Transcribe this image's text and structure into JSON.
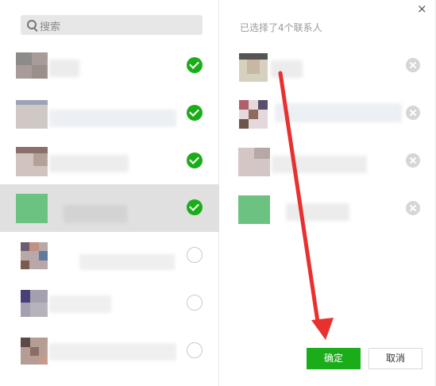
{
  "search": {
    "placeholder": "搜索"
  },
  "right": {
    "title": "已选择了4个联系人"
  },
  "buttons": {
    "ok": "确定",
    "cancel": "取消"
  },
  "close": "×",
  "colors": {
    "accent": "#1aad19",
    "selected_bg": "#e0e0e0",
    "arrow": "#e8312f"
  },
  "contacts": [
    {
      "checked": true
    },
    {
      "checked": true
    },
    {
      "checked": true
    },
    {
      "checked": true,
      "selected": true
    },
    {
      "checked": false
    },
    {
      "checked": false
    },
    {
      "checked": false
    }
  ],
  "selected_count": 4
}
